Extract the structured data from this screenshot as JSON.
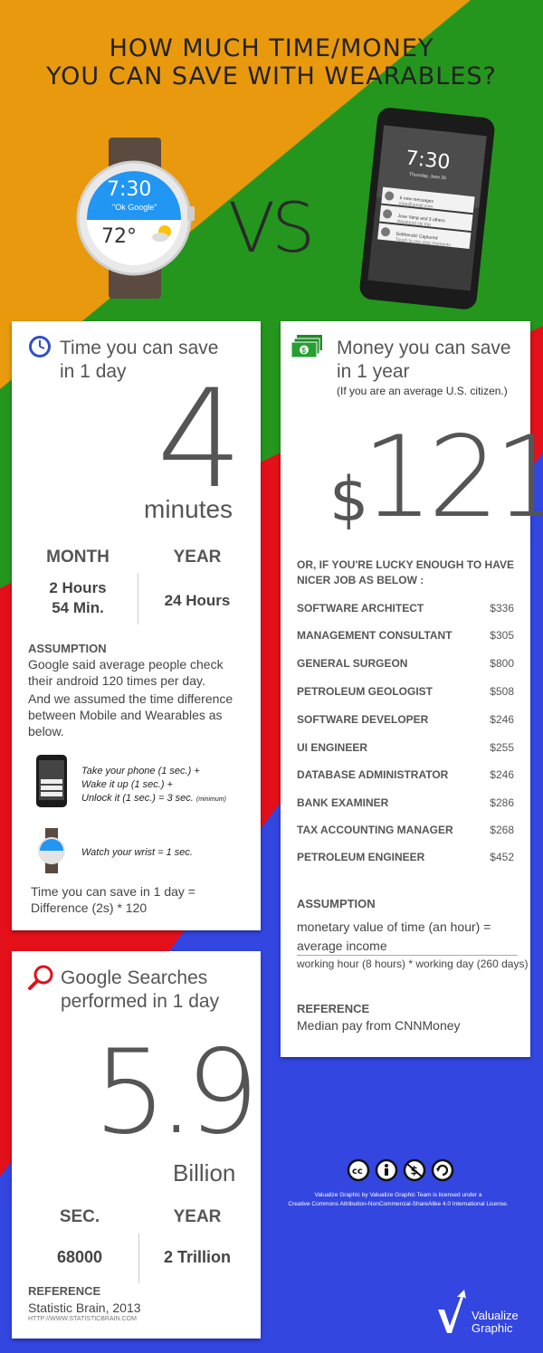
{
  "colors": {
    "orange": "#E8990E",
    "green": "#24961E",
    "red": "#E3101A",
    "blue": "#3346E0"
  },
  "title": {
    "line1": "HOW MUCH TIME/MONEY",
    "line2": "YOU CAN SAVE WITH WEARABLES?"
  },
  "hero": {
    "watch_time": "7:30",
    "watch_prompt": "\"Ok Google\"",
    "watch_temp": "72°",
    "vs": "VS",
    "phone_time": "7:30",
    "phone_date": "Thursday, June 26",
    "notifications": [
      {
        "title": "6 new messages",
        "sub": "jdoe@gmail.com"
      },
      {
        "title": "Jose Vang and 3 others",
        "sub": "Weekend ski trip"
      },
      {
        "title": "Girlfriends! Captured",
        "sub": "Touch to see your moments"
      }
    ]
  },
  "time_card": {
    "icon": "clock-icon",
    "heading_line1": "Time you can save",
    "heading_line2": "in 1 day",
    "number": "4",
    "unit": "minutes",
    "month_label": "MONTH",
    "month_value_line1": "2 Hours",
    "month_value_line2": "54 Min.",
    "year_label": "YEAR",
    "year_value": "24 Hours",
    "assumption_label": "ASSUMPTION",
    "assumption_p1_line1": "Google said average people check",
    "assumption_p1_line2": "their android 120 times per day.",
    "assumption_p2_line1": "And we assumed the time difference",
    "assumption_p2_line2": "between Mobile and Wearables as",
    "assumption_p2_line3": "below.",
    "phone_step1": "Take your phone (1 sec.) +",
    "phone_step2": "Wake it up (1 sec.) +",
    "phone_step3": "Unlock it (1 sec.) = 3 sec.",
    "phone_step3_note": "(minimum)",
    "watch_step": "Watch your wrist = 1 sec.",
    "formula_line1": "Time you can save in 1 day =",
    "formula_line2": "Difference (2s) * 120"
  },
  "money_card": {
    "icon": "money-icon",
    "heading_line1": "Money you can save",
    "heading_line2": "in 1 year",
    "subheading": "(If you are an average U.S. citizen.)",
    "currency": "$",
    "number": "121",
    "lucky_line1": "OR, IF YOU'RE LUCKY ENOUGH TO HAVE",
    "lucky_line2": "NICER JOB AS BELOW :",
    "jobs": [
      {
        "name": "SOFTWARE ARCHITECT",
        "value": "$336"
      },
      {
        "name": "MANAGEMENT CONSULTANT",
        "value": "$305"
      },
      {
        "name": "GENERAL SURGEON",
        "value": "$800"
      },
      {
        "name": "PETROLEUM GEOLOGIST",
        "value": "$508"
      },
      {
        "name": "SOFTWARE DEVELOPER",
        "value": "$246"
      },
      {
        "name": "UI ENGINEER",
        "value": "$255"
      },
      {
        "name": "DATABASE ADMINISTRATOR",
        "value": "$246"
      },
      {
        "name": "BANK EXAMINER",
        "value": "$286"
      },
      {
        "name": "TAX ACCOUNTING MANAGER",
        "value": "$268"
      },
      {
        "name": "PETROLEUM ENGINEER",
        "value": "$452"
      }
    ],
    "assumption_label": "ASSUMPTION",
    "numerator_line1": "monetary value of time (an hour) =",
    "numerator_line2": "average income",
    "denominator": "working hour (8 hours) * working day (260 days)",
    "reference_label": "REFERENCE",
    "reference_text": "Median pay from CNNMoney"
  },
  "search_card": {
    "icon": "magnifier-icon",
    "heading_line1": "Google Searches",
    "heading_line2": "performed in 1 day",
    "number": "5.9",
    "unit": "Billion",
    "sec_label": "SEC.",
    "sec_value": "68000",
    "year_label": "YEAR",
    "year_value": "2 Trillion",
    "reference_label": "REFERENCE",
    "reference_text": "Statistic Brain, 2013",
    "reference_url": "HTTP://WWW.STATISTICBRAIN.COM"
  },
  "license": {
    "line1": "Valualize Graphic by Valualize Graphic Team is licensed under a",
    "line2": "Creative Commons Attribution-NonCommercial-ShareAlike 4.0 International License."
  },
  "brand": {
    "line1": "Valualize",
    "line2": "Graphic"
  }
}
